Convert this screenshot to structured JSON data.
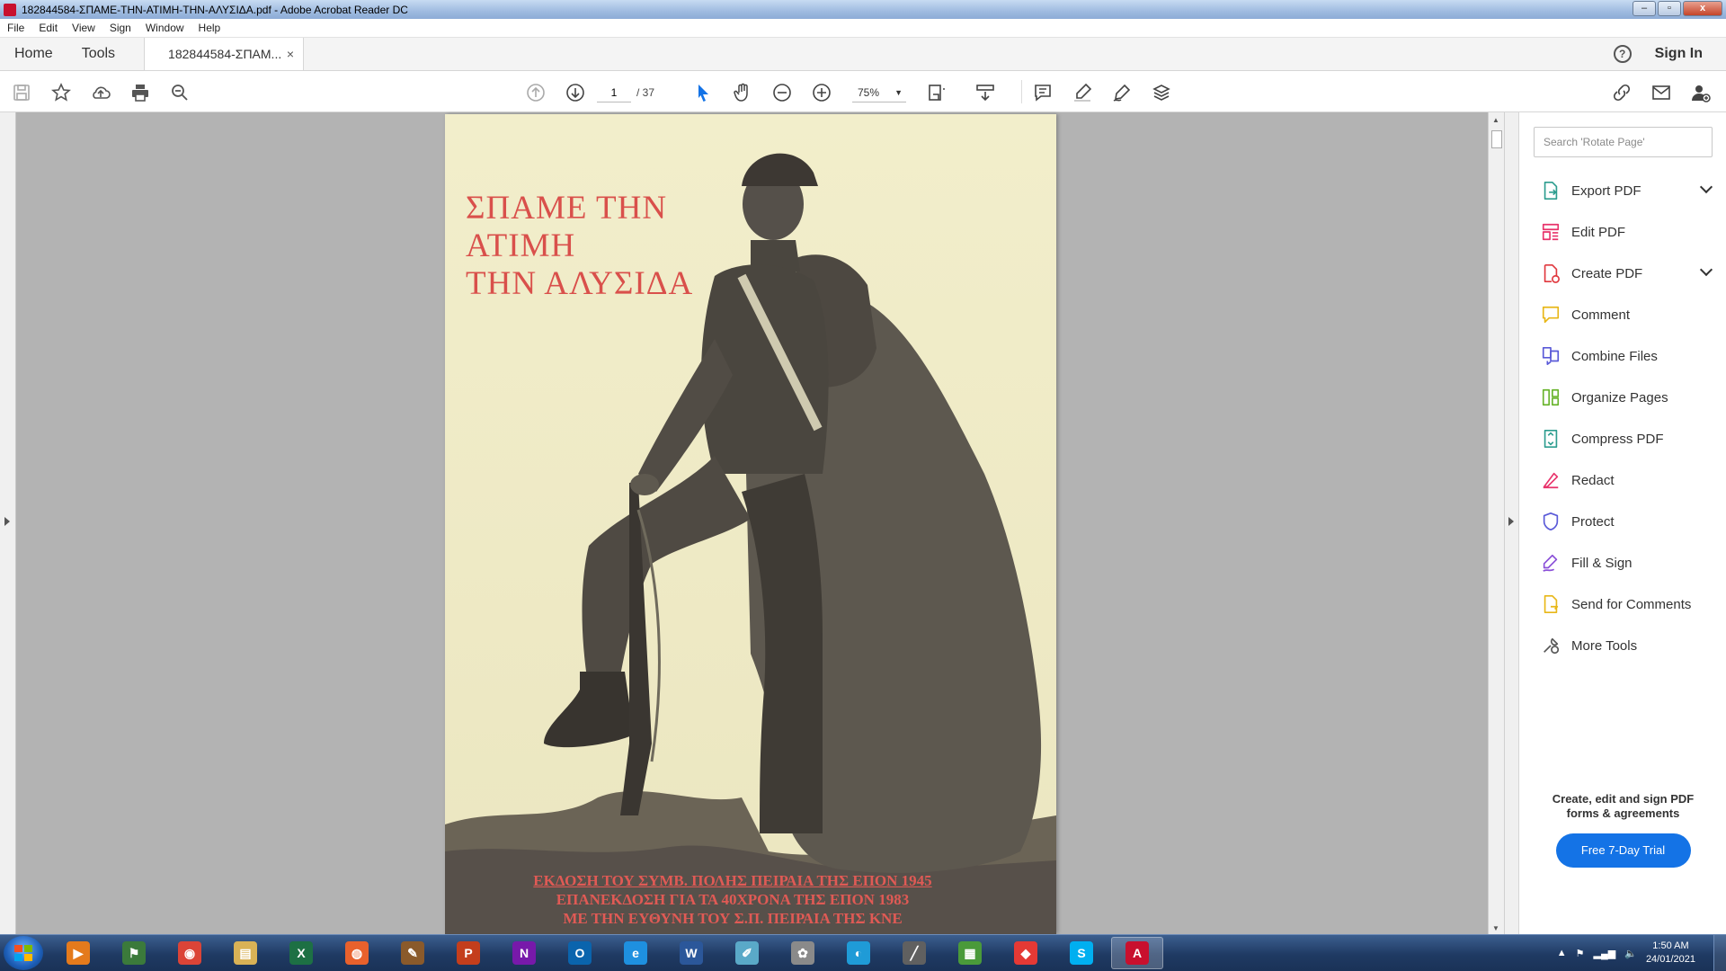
{
  "window": {
    "title": "182844584-ΣΠΑΜΕ-ΤΗΝ-ΑΤΙΜΗ-ΤΗΝ-ΑΛΥΣΙΔΑ.pdf - Adobe Acrobat Reader DC",
    "minimize": "–",
    "maximize": "▫",
    "close": "x"
  },
  "menu": [
    "File",
    "Edit",
    "View",
    "Sign",
    "Window",
    "Help"
  ],
  "tabs": {
    "home": "Home",
    "tools": "Tools",
    "document": "182844584-ΣΠΑΜ...",
    "close": "×",
    "help": "?",
    "sign_in": "Sign In"
  },
  "toolbar": {
    "page_current": "1",
    "page_total": "/ 37",
    "zoom": "75%"
  },
  "document": {
    "title_lines": [
      "ΣΠΑΜΕ ΤΗΝ",
      "ΑΤΙΜΗ",
      "ΤΗΝ ΑΛΥΣΙΔΑ"
    ],
    "credit_lines": [
      "ΕΚΔΟΣΗ ΤΟΥ ΣΥΜΒ. ΠΟΛΗΣ ΠΕΙΡΑΙΑ ΤΗΣ ΕΠΟΝ 1945",
      "ΕΠΑΝΕΚΔΟΣΗ ΓΙΑ ΤΑ 40ΧΡΟΝΑ ΤΗΣ ΕΠΟΝ 1983",
      "ΜΕ ΤΗΝ ΕΥΘΥΝΗ ΤΟΥ Σ.Π. ΠΕΙΡΑΙΑ ΤΗΣ ΚΝΕ"
    ]
  },
  "tools_pane": {
    "search_placeholder": "Search 'Rotate Page'",
    "items": [
      {
        "label": "Export PDF",
        "icon": "export-pdf-icon",
        "color": "#2d9d8f"
      },
      {
        "label": "Edit PDF",
        "icon": "edit-pdf-icon",
        "color": "#e8336b"
      },
      {
        "label": "Create PDF",
        "icon": "create-pdf-icon",
        "color": "#e0383e"
      },
      {
        "label": "Comment",
        "icon": "comment-icon",
        "color": "#e8b718"
      },
      {
        "label": "Combine Files",
        "icon": "combine-files-icon",
        "color": "#5a5ad8"
      },
      {
        "label": "Organize Pages",
        "icon": "organize-pages-icon",
        "color": "#6ab42d"
      },
      {
        "label": "Compress PDF",
        "icon": "compress-pdf-icon",
        "color": "#2d9d8f"
      },
      {
        "label": "Redact",
        "icon": "redact-icon",
        "color": "#e8336b"
      },
      {
        "label": "Protect",
        "icon": "protect-icon",
        "color": "#5a5ad8"
      },
      {
        "label": "Fill & Sign",
        "icon": "fill-sign-icon",
        "color": "#8a4fd8"
      },
      {
        "label": "Send for Comments",
        "icon": "send-for-comments-icon",
        "color": "#e8b718"
      },
      {
        "label": "More Tools",
        "icon": "more-tools-icon",
        "color": "#555555"
      }
    ],
    "promo_text": "Create, edit and sign PDF forms & agreements",
    "trial_button": "Free 7-Day Trial"
  },
  "taskbar": {
    "apps": [
      {
        "name": "media-player",
        "glyph": "▶",
        "color": "#e47a1c"
      },
      {
        "name": "network",
        "glyph": "⚑",
        "color": "#3b7a3b"
      },
      {
        "name": "chrome",
        "glyph": "◉",
        "color": "#db4437"
      },
      {
        "name": "file-explorer",
        "glyph": "▤",
        "color": "#d9b256"
      },
      {
        "name": "excel",
        "glyph": "X",
        "color": "#1d7044"
      },
      {
        "name": "firefox",
        "glyph": "◍",
        "color": "#e8612c"
      },
      {
        "name": "paint",
        "glyph": "✎",
        "color": "#8a5a2b"
      },
      {
        "name": "powerpoint",
        "glyph": "P",
        "color": "#c43e1c"
      },
      {
        "name": "onenote",
        "glyph": "N",
        "color": "#7719aa"
      },
      {
        "name": "outlook",
        "glyph": "O",
        "color": "#0a64ad"
      },
      {
        "name": "internet-explorer",
        "glyph": "e",
        "color": "#1e90e0"
      },
      {
        "name": "word",
        "glyph": "W",
        "color": "#2b579a"
      },
      {
        "name": "notes",
        "glyph": "✐",
        "color": "#5aa9c8"
      },
      {
        "name": "paint-palette",
        "glyph": "✿",
        "color": "#8a8a8a"
      },
      {
        "name": "edge",
        "glyph": "◐",
        "color": "#1f9bd7"
      },
      {
        "name": "tool",
        "glyph": "╱",
        "color": "#606060"
      },
      {
        "name": "project",
        "glyph": "▦",
        "color": "#4a9a3a"
      },
      {
        "name": "anydesk",
        "glyph": "◆",
        "color": "#e53935"
      },
      {
        "name": "skype",
        "glyph": "S",
        "color": "#00aff0"
      },
      {
        "name": "acrobat",
        "glyph": "A",
        "color": "#c8102e"
      }
    ],
    "clock_time": "1:50 AM",
    "clock_date": "24/01/2021"
  }
}
